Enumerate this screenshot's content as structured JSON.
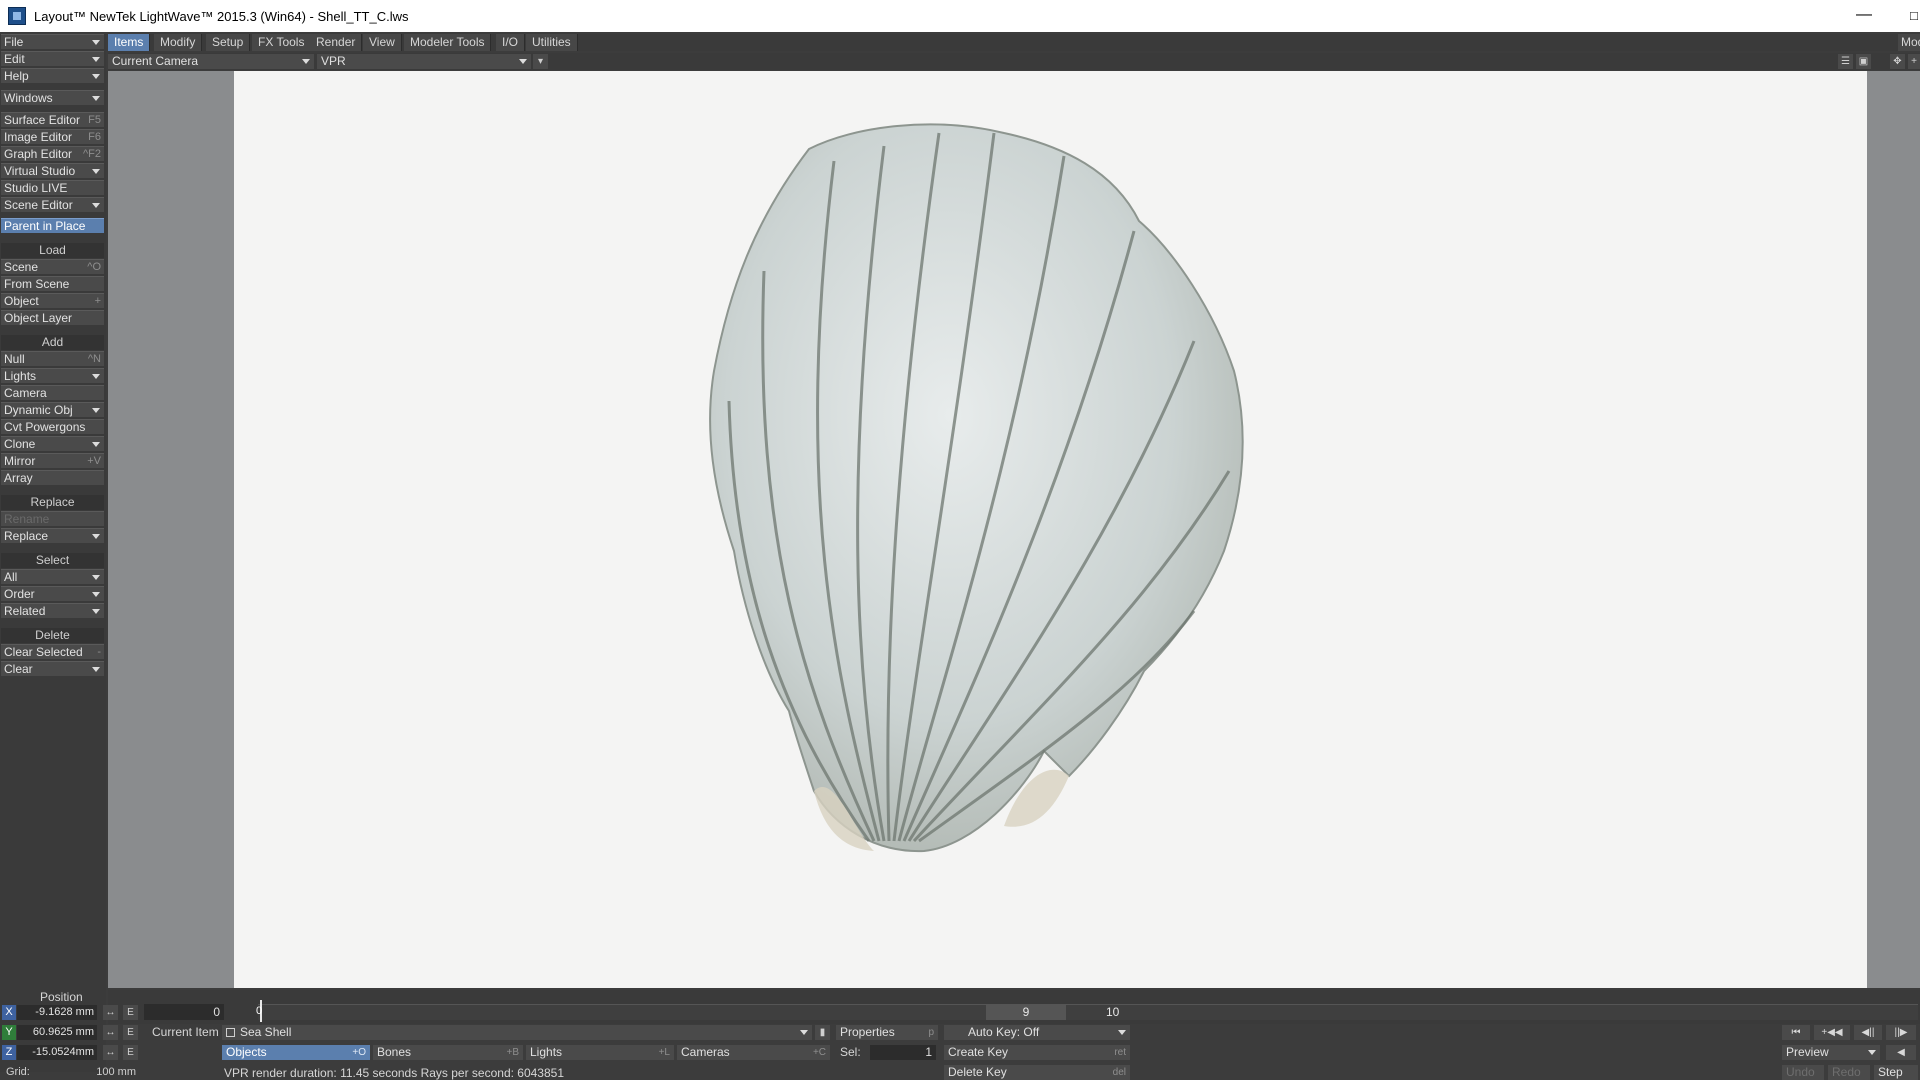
{
  "window": {
    "title": "Layout™ NewTek LightWave™ 2015.3 (Win64) - Shell_TT_C.lws",
    "minimize": "—",
    "maximize_partial": "□"
  },
  "left_panel": {
    "file": "File",
    "edit": "Edit",
    "help": "Help",
    "windows": "Windows",
    "surface_editor": "Surface Editor",
    "surface_editor_sc": "F5",
    "image_editor": "Image Editor",
    "image_editor_sc": "F6",
    "graph_editor": "Graph Editor",
    "graph_editor_sc": "^F2",
    "virtual_studio": "Virtual Studio",
    "studio_live": "Studio LIVE",
    "scene_editor": "Scene Editor",
    "parent_in_place": "Parent in Place",
    "load_head": "Load",
    "scene": "Scene",
    "scene_sc": "^O",
    "from_scene": "From Scene",
    "object": "Object",
    "object_sc": "+",
    "object_layer": "Object Layer",
    "add_head": "Add",
    "null": "Null",
    "null_sc": "^N",
    "lights": "Lights",
    "camera": "Camera",
    "dynamic_obj": "Dynamic Obj",
    "cvt_powergons": "Cvt Powergons",
    "clone": "Clone",
    "mirror": "Mirror",
    "mirror_sc": "+V",
    "array": "Array",
    "replace_head": "Replace",
    "rename": "Rename",
    "replace": "Replace",
    "select_head": "Select",
    "all": "All",
    "order": "Order",
    "related": "Related",
    "delete_head": "Delete",
    "clear_selected": "Clear Selected",
    "clear_selected_sc": "-",
    "clear": "Clear"
  },
  "tabs": [
    "Items",
    "Modify",
    "Setup",
    "FX Tools",
    "Render",
    "View",
    "Modeler Tools",
    "I/O",
    "Utilities"
  ],
  "tab_right": "Mod",
  "viewport": {
    "camera_select": "Current Camera",
    "mode_select": "VPR"
  },
  "timeline": {
    "current_frame": "0",
    "marker_label": "0",
    "end_frame_field": "9",
    "end_label": "10"
  },
  "position": {
    "label": "Position",
    "x_axis": "X",
    "y_axis": "Y",
    "z_axis": "Z",
    "x": "-9.1628 mm",
    "y": "60.9625 mm",
    "z": "-15.0524mm",
    "e": "E",
    "grid_label": "Grid:",
    "grid_value": "100 mm"
  },
  "item_bar": {
    "current_item_label": "Current Item",
    "current_item": "Sea Shell",
    "properties": "Properties",
    "properties_sc": "p",
    "auto_key": "Auto Key: Off",
    "objects": "Objects",
    "objects_sc": "+O",
    "bones": "Bones",
    "bones_sc": "+B",
    "lights": "Lights",
    "lights_sc": "+L",
    "cameras": "Cameras",
    "cameras_sc": "+C",
    "sel_label": "Sel:",
    "sel_value": "1",
    "create_key": "Create Key",
    "create_key_sc": "ret",
    "delete_key": "Delete Key",
    "delete_key_sc": "del",
    "status": "VPR render duration: 11.45 seconds   Rays per second: 6043851"
  },
  "transport": {
    "preview": "Preview",
    "undo": "Undo",
    "redo": "Redo",
    "step": "Step"
  }
}
